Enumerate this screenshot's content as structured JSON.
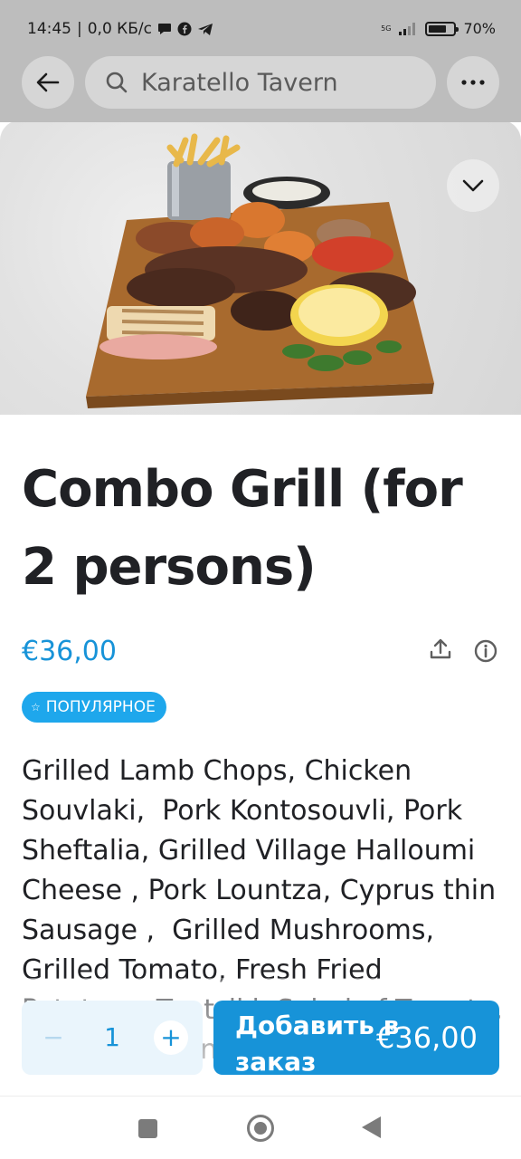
{
  "status_bar": {
    "time": "14:45",
    "speed": "0,0 КБ/с",
    "network": "5G",
    "battery_level": 0.7,
    "battery_text": "70%"
  },
  "header": {
    "search_text": "Karatello Tavern",
    "icons": {
      "back": "arrow-left-icon",
      "search": "search-icon",
      "more": "more-horizontal-icon"
    }
  },
  "hero": {
    "image_subject": "grill-platter-photo",
    "collapse_icon": "chevron-down-icon"
  },
  "item": {
    "title": "Combo Grill (for 2 persons)",
    "price": "€36,00",
    "badge": "ПОПУЛЯРНОЕ",
    "description": "Grilled Lamb Chops, Chicken Souvlaki,  Pork Kontosouvli, Pork Sheftalia, Grilled Village Halloumi Cheese , Pork Lountza, Cyprus thin Sausage ,  Grilled Mushrooms,\nGrilled Tomato, Fresh Fried Potatoes, Tzatziki, Salad of Tomato, Cucumber, Onion &"
  },
  "order_bar": {
    "quantity": "1",
    "minus_symbol": "−",
    "plus_symbol": "+",
    "add_label": "Добавить в заказ",
    "add_price": "€36,00"
  },
  "colors": {
    "accent": "#1793d8",
    "badge": "#1ea7ec",
    "qty_background": "#eaf5fc",
    "text": "#202125"
  }
}
